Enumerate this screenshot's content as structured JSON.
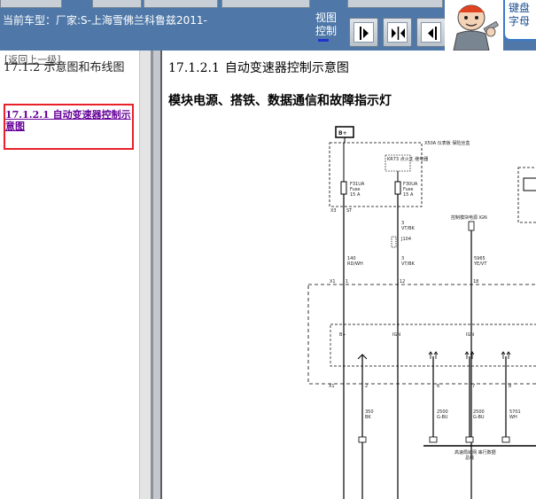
{
  "toolbar": {
    "car_label": "当前车型：厂家:S-上海雪佛兰科鲁兹2011-",
    "view_label": "视图",
    "control_label": "控制",
    "view_buttons": [
      "first-page",
      "fit-both",
      "prev-page"
    ],
    "help_text_line1": "键盘",
    "help_text_line2": "字母"
  },
  "left_panel": {
    "back_link": "[返回上一级]",
    "section_title": "17.1.2 示意图和布线图",
    "sub_link": "17.1.2.1 自动变速器控制示意图"
  },
  "content": {
    "title_num": "17.1.2.1",
    "title_text": "自动变速器控制示意图",
    "heading": "模块电源、搭铁、数据通信和故障指示灯"
  },
  "diagram": {
    "battery_label": "B+",
    "fuse_block_label": "X50A 仪表板 保险丝盒",
    "relay_label": "KR73 点火主 继电器",
    "fuse1_name": "F31UA",
    "fuse1_text": "Fuse",
    "fuse1_amp": "15 A",
    "fuse2_name": "F30UA",
    "fuse2_text": "Fuse",
    "fuse2_amp": "15 A",
    "conn1": "X3",
    "conn1_pin": "ST",
    "wire1_pin": "140",
    "wire1_color": "RD/WH",
    "wire2_pin": "3",
    "wire2_color": "VT/BK",
    "splice_label": "J104",
    "wire3_pin": "3",
    "wire3_color": "VT/BK",
    "power_mode_label": "控制模块电源 IGN",
    "wire4_pin": "5965",
    "wire4_color": "YE/VT",
    "module_conn": "X1",
    "pin1": "1",
    "pin12": "12",
    "pin18": "18",
    "term1": "B+",
    "term2": "IGN",
    "term3": "IGN",
    "conn2": "X1",
    "pin2": "2",
    "pin6": "6",
    "pin7": "7",
    "pin8": "8",
    "gnd_wire": "350",
    "gnd_color": "BK",
    "can1_wire": "2500",
    "can1_color": "G-BU",
    "can2_wire": "2500",
    "can2_color": "G-BU",
    "can3_wire": "5701",
    "can3_color": "WH",
    "bus_label": "高速局域网 串行数据",
    "bus_sub": "总线"
  }
}
